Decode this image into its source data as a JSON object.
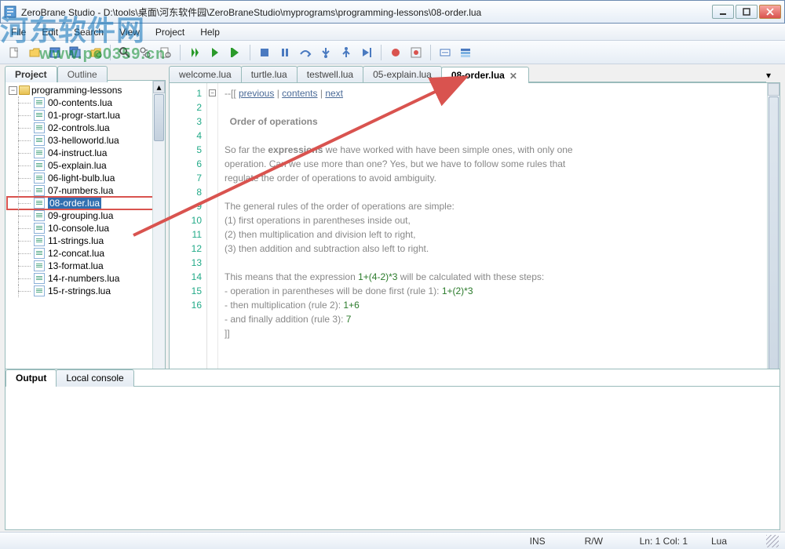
{
  "window": {
    "title": "ZeroBrane Studio - D:\\tools\\桌面\\河东软件园\\ZeroBraneStudio\\myprograms\\programming-lessons\\08-order.lua",
    "min_tooltip": "Minimize",
    "max_tooltip": "Maximize",
    "close_tooltip": "Close"
  },
  "watermark": {
    "brand": "河东软件网",
    "url": "www.pc0359.cn"
  },
  "menu": {
    "items": [
      "File",
      "Edit",
      "Search",
      "View",
      "Project",
      "Help"
    ]
  },
  "sidebar_tabs": {
    "project": "Project",
    "outline": "Outline"
  },
  "project_tree": {
    "root": "programming-lessons",
    "files": [
      "00-contents.lua",
      "01-progr-start.lua",
      "02-controls.lua",
      "03-helloworld.lua",
      "04-instruct.lua",
      "05-explain.lua",
      "06-light-bulb.lua",
      "07-numbers.lua",
      "08-order.lua",
      "09-grouping.lua",
      "10-console.lua",
      "11-strings.lua",
      "12-concat.lua",
      "13-format.lua",
      "14-r-numbers.lua",
      "15-r-strings.lua"
    ],
    "selected_index": 8
  },
  "editor_tabs": {
    "tabs": [
      "welcome.lua",
      "turtle.lua",
      "testwell.lua",
      "05-explain.lua",
      "08-order.lua"
    ],
    "active_index": 4
  },
  "code": {
    "line_numbers": [
      1,
      2,
      3,
      4,
      5,
      6,
      7,
      8,
      9,
      10,
      11,
      12,
      13,
      14,
      15,
      16
    ],
    "l1_prefix": "--[[ ",
    "l1_prev": "previous",
    "l1_sep": " | ",
    "l1_contents": "contents",
    "l1_next": "next",
    "l3": "  Order of operations",
    "l5a": "So far the ",
    "l5b": "expressions",
    "l5c": " we have worked with have been simple ones, with only one",
    "l5d": "operation. Can we use more than one? Yes, but we have to follow some rules that",
    "l5e": "regulate the order of operations to avoid ambiguity.",
    "l7": "The general rules of the order of operations are simple:",
    "l8": "(1) first operations in parentheses inside out,",
    "l9": "(2) then multiplication and division left to right,",
    "l10": "(3) then addition and subtraction also left to right.",
    "l12a": "This means that the expression ",
    "l12b": "1+(4-2)*3",
    "l12c": " will be calculated with these steps:",
    "l13a": "- operation in parentheses will be done first (rule 1): ",
    "l13b": "1+(2)*3",
    "l14a": "- then multiplication (rule 2): ",
    "l14b": "1+6",
    "l15a": "- and finally addition (rule 3): ",
    "l15b": "7",
    "l16": "]]"
  },
  "bottom_tabs": {
    "output": "Output",
    "console": "Local console"
  },
  "status": {
    "ins": "INS",
    "rw": "R/W",
    "pos": "Ln: 1 Col: 1",
    "lang": "Lua"
  }
}
